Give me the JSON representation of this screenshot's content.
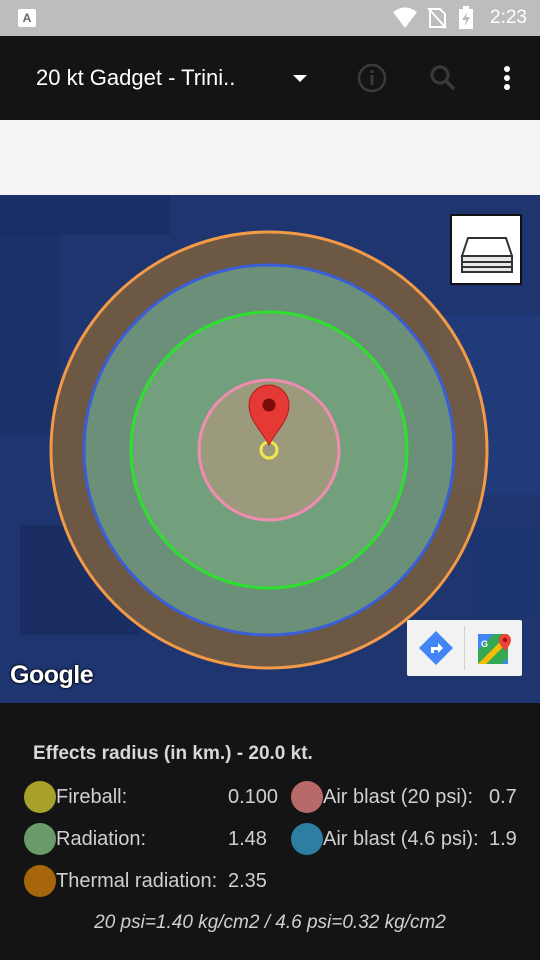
{
  "status_bar": {
    "time": "2:23",
    "app_badge": "A",
    "icons": [
      "wifi-icon",
      "no-sim-icon",
      "battery-charging-icon"
    ]
  },
  "toolbar": {
    "title": "20 kt Gadget - Trini..",
    "icons": [
      "chevron-down-icon",
      "info-icon",
      "search-icon",
      "more-vert-icon"
    ]
  },
  "map": {
    "google_label": "Google",
    "colors": {
      "thermal": "#f39a47",
      "air_blast_4_6": "#3a5ed8",
      "radiation": "#2ee02e",
      "air_blast_20": "#f08cb0",
      "marker": "#e53935",
      "ground_zero": "#f2e84a"
    }
  },
  "legend": {
    "heading": "Effects radius (in km.) - 20.0 kt.",
    "left": [
      {
        "label": "Fireball:",
        "value": "0.100",
        "color": "#a8a22a"
      },
      {
        "label": "Radiation:",
        "value": "1.48",
        "color": "#6a9a6a"
      },
      {
        "label": "Thermal radiation:",
        "value": "2.35",
        "color": "#a8660c"
      }
    ],
    "right": [
      {
        "label": "Air blast (20 psi):",
        "value": "0.7",
        "color": "#b86a6a"
      },
      {
        "label": "Air blast (4.6 psi):",
        "value": "1.9",
        "color": "#2d7ea0"
      }
    ],
    "footnote": "20 psi=1.40 kg/cm2 / 4.6 psi=0.32 kg/cm2"
  }
}
